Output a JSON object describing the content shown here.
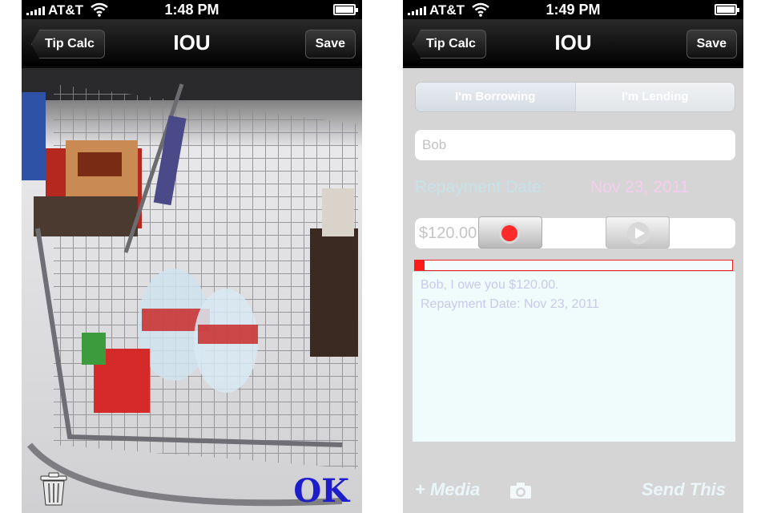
{
  "left_screen": {
    "status_bar": {
      "carrier": "AT&T",
      "time": "1:48 PM"
    },
    "nav_bar": {
      "back_label": "Tip Calc",
      "title": "IOU",
      "save_label": "Save"
    },
    "photo_toolbar": {
      "ok_label": "OK",
      "trash_icon": "trash-icon"
    }
  },
  "right_screen": {
    "status_bar": {
      "carrier": "AT&T",
      "time": "1:49 PM"
    },
    "nav_bar": {
      "back_label": "Tip Calc",
      "title": "IOU",
      "save_label": "Save"
    },
    "form": {
      "segments": [
        "I'm Borrowing",
        "I'm Lending"
      ],
      "name_value": "Bob",
      "repayment_label": "Repayment Date:",
      "repayment_date": "Nov 23, 2011",
      "amount_value": "$120.00",
      "record_icon": "record-icon",
      "play_icon": "play-icon",
      "recording_progress": 0.03,
      "message_line1": "Bob, I owe you $120.00.",
      "message_line2": "Repayment Date: Nov 23, 2011"
    },
    "bottom_bar": {
      "media_label": "+ Media",
      "camera_icon": "camera-icon",
      "send_label": "Send This"
    }
  },
  "colors": {
    "nav_dark": "#000000",
    "form_bg": "#d5d5d5",
    "repay_label": "#c5e3e9",
    "repay_date": "#f5cdee",
    "ok_blue": "#1d1dcc",
    "record_red": "#ff2a2a"
  }
}
